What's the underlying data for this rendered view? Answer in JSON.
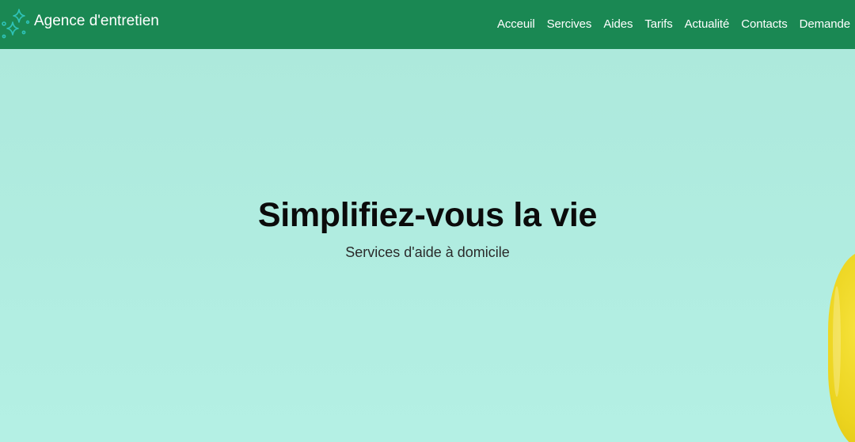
{
  "brand": {
    "name": "Agence d'entretien",
    "icon": "sparkle-stars-icon",
    "icon_color": "#2fc2b7"
  },
  "nav": {
    "items": [
      {
        "label": "Acceuil"
      },
      {
        "label": "Sercives"
      },
      {
        "label": "Aides"
      },
      {
        "label": "Tarifs"
      },
      {
        "label": "Actualité"
      },
      {
        "label": "Contacts"
      },
      {
        "label": "Demande"
      }
    ]
  },
  "hero": {
    "title": "Simplifiez-vous la vie",
    "subtitle": "Services d'aide à domicile"
  },
  "colors": {
    "navbar": "#1a8853",
    "hero_background": "#b1ece0",
    "accent_yellow": "#ecd41f"
  }
}
